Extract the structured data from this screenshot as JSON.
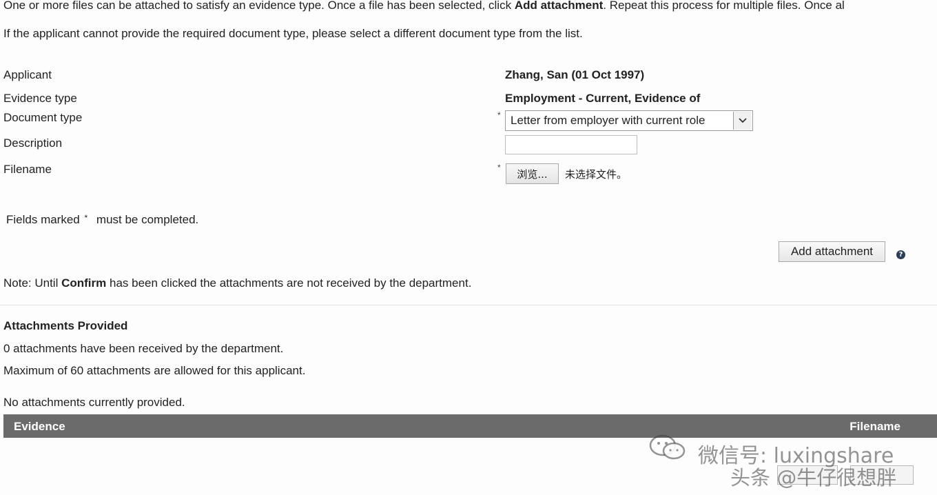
{
  "instructions": {
    "line1_part1": "One or more files can be attached to satisfy an evidence type. Once a file has been selected, click ",
    "line1_bold": "Add attachment",
    "line1_part2": ". Repeat this process for multiple files. Once al",
    "line2": "If the applicant cannot provide the required document type, please select a different document type from the list."
  },
  "form": {
    "applicant_label": "Applicant",
    "applicant_value": "Zhang, San (01 Oct 1997)",
    "evidence_type_label": "Evidence type",
    "evidence_type_value": "Employment - Current, Evidence of",
    "document_type_label": "Document type",
    "document_type_value": "Letter from employer with current role",
    "description_label": "Description",
    "description_value": "",
    "filename_label": "Filename",
    "browse_label": "浏览...",
    "no_file_text": "未选择文件。",
    "required_marker": "*"
  },
  "fields_note": {
    "part1": "Fields marked",
    "marker": "*",
    "part2": "must be completed."
  },
  "add_attachment_label": "Add attachment",
  "help_icon_glyph": "?",
  "note": {
    "part1": "Note: Until ",
    "bold": "Confirm",
    "part2": " has been clicked the attachments are not received by the department."
  },
  "attachments": {
    "heading": "Attachments Provided",
    "received_text": "0 attachments have been received by the department.",
    "max_text": "Maximum of 60 attachments are allowed for this applicant.",
    "none_text": "No attachments currently provided.",
    "columns": [
      "Evidence",
      "Filename"
    ]
  },
  "watermark": {
    "line1": "微信号: luxingshare",
    "line2": "头条 @牛仔很想胖",
    "icon": "wechat-icon"
  },
  "colors": {
    "table_header_bg": "#6b6b6b",
    "help_icon_bg": "#2c3e57"
  }
}
